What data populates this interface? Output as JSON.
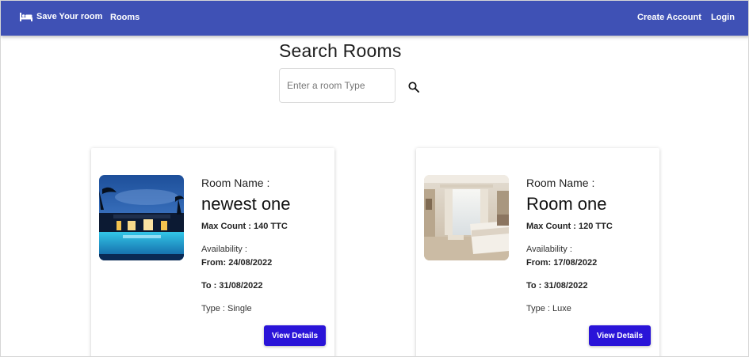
{
  "navbar": {
    "brand_label": "Save Your room",
    "brand_icon": "bed-icon",
    "rooms_link": "Rooms",
    "create_account_link": "Create Account",
    "login_link": "Login",
    "color": "#3f51b5"
  },
  "search": {
    "title": "Search Rooms",
    "placeholder": "Enter a room Type",
    "value": "",
    "button_icon": "search-icon"
  },
  "rooms": [
    {
      "name_label": "Room Name :",
      "name": "newest one",
      "max_count": "Max Count : 140 TTC",
      "availability_label": "Availability :",
      "from": "From: 24/08/2022",
      "to": "To : 31/08/2022",
      "type": "Type : Single",
      "button_label": "View Details"
    },
    {
      "name_label": "Room Name :",
      "name": "Room one",
      "max_count": "Max Count : 120 TTC",
      "availability_label": "Availability :",
      "from": "From: 17/08/2022",
      "to": "To : 31/08/2022",
      "type": "Type : Luxe",
      "button_label": "View Details"
    }
  ],
  "accent_button_color": "#2a14d8"
}
